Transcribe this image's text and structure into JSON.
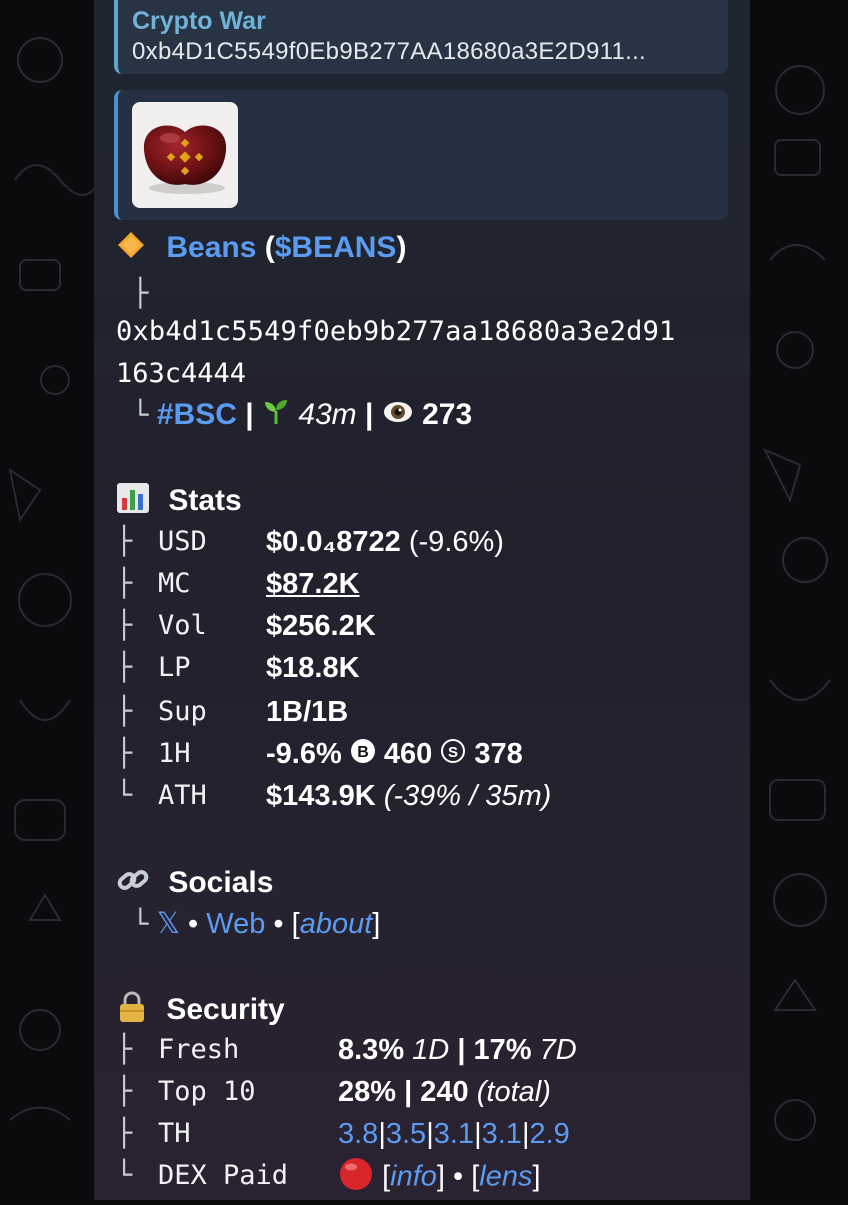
{
  "reply": {
    "title": "Crypto War",
    "subtitle": "0xb4D1C5549f0Eb9B277AA18680a3E2D911..."
  },
  "media": {
    "image": "bean-with-bnb-logo"
  },
  "token": {
    "name": "Beans",
    "ticker": "$BEANS",
    "address_line1": "0xb4d1c5549f0eb9b277aa18680a3e2d91",
    "address_line2": "163c4444",
    "chain": "#BSC",
    "age": "43m",
    "views": "273"
  },
  "stats": {
    "heading": "Stats",
    "rows": [
      {
        "label": "USD",
        "value": "$0.0₄8722",
        "extra": "(-9.6%)"
      },
      {
        "label": "MC",
        "value": "$87.2K"
      },
      {
        "label": "Vol",
        "value": "$256.2K"
      },
      {
        "label": "LP",
        "value": "$18.8K"
      },
      {
        "label": "Sup",
        "value": "1B/1B"
      },
      {
        "label": "1H",
        "value": "-9.6%",
        "buys": "460",
        "sells": "378"
      },
      {
        "label": "ATH",
        "value": "$143.9K",
        "extra": "(-39% / 35m)"
      }
    ]
  },
  "socials": {
    "heading": "Socials",
    "x": "𝕏",
    "web": "Web",
    "about": "about"
  },
  "security": {
    "heading": "Security",
    "fresh_label": "Fresh",
    "fresh_1d": "8.3%",
    "fresh_1d_unit": "1D",
    "fresh_7d": "17%",
    "fresh_7d_unit": "7D",
    "top10_label": "Top 10",
    "top10_pct": "28%",
    "top10_total": "240",
    "top10_total_label": "(total)",
    "th_label": "TH",
    "th_values": [
      "3.8",
      "3.5",
      "3.1",
      "3.1",
      "2.9"
    ],
    "dex_label": "DEX Paid",
    "info": "info",
    "lens": "lens"
  },
  "colors": {
    "link": "#5b9bf0",
    "reply_accent": "#5ea6c9",
    "bubble_bg": "#22212d"
  }
}
